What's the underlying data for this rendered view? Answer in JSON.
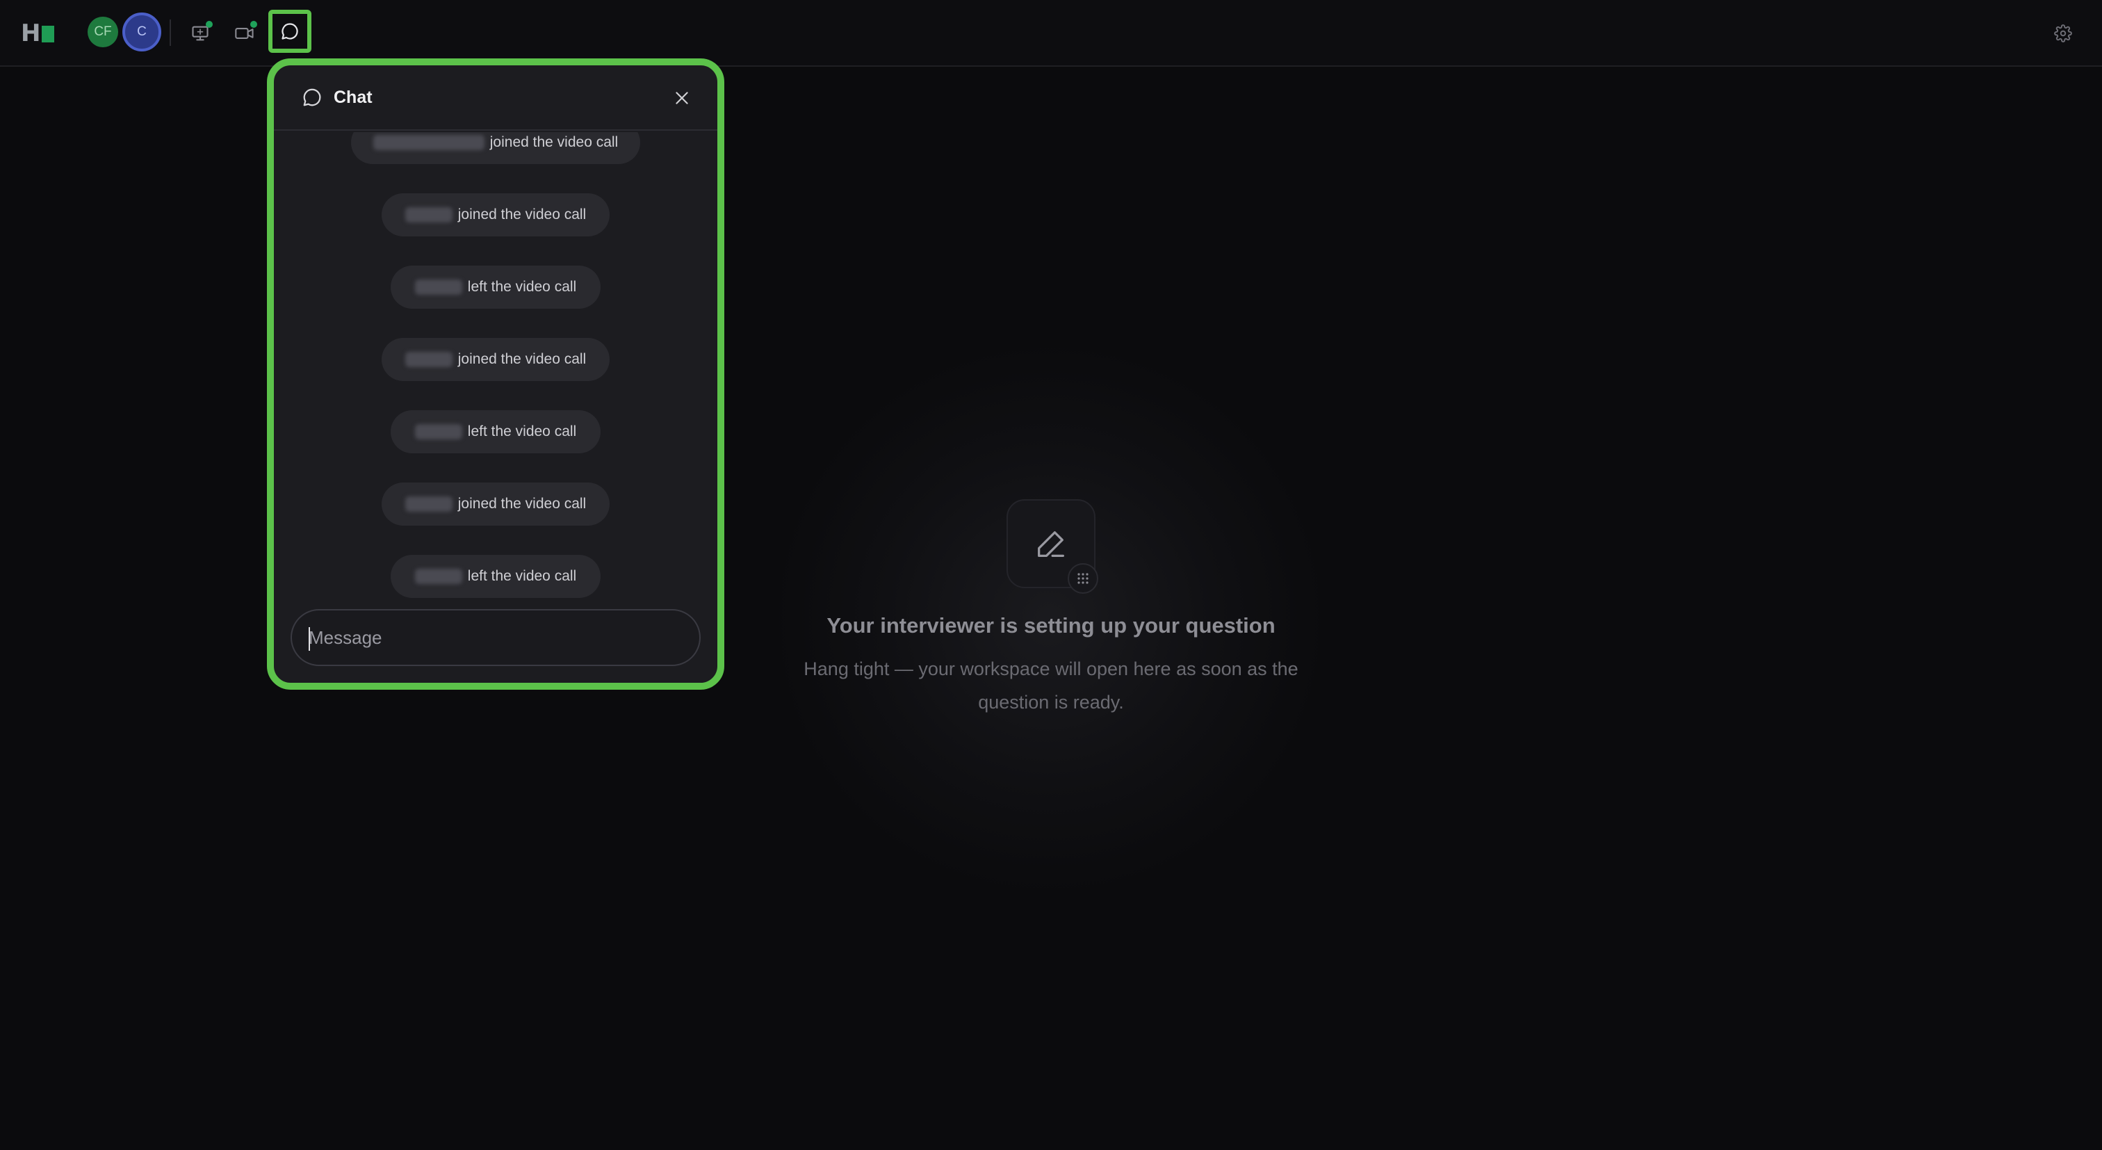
{
  "topbar": {
    "logo_letter": "H",
    "avatars": [
      {
        "initials": "CF",
        "color": "#1e7a3e"
      },
      {
        "initials": "C",
        "color": "#2c3a8a"
      }
    ],
    "icons": [
      "screen-share-icon",
      "video-camera-icon",
      "chat-bubble-icon",
      "gear-icon"
    ],
    "active_indicator_color": "#1fa25a"
  },
  "chat": {
    "title": "Chat",
    "highlight_color": "#5cc24a",
    "messages": [
      {
        "text": "joined the video call"
      },
      {
        "text": "joined the video call"
      },
      {
        "text": "left the video call"
      },
      {
        "text": "joined the video call"
      },
      {
        "text": "left the video call"
      },
      {
        "text": "joined the video call"
      },
      {
        "text": "left the video call"
      }
    ],
    "input_placeholder": "Message"
  },
  "main": {
    "title": "Your interviewer is setting up your question",
    "subtitle_line1": "Hang tight — your workspace will open here as soon as the",
    "subtitle_line2": "question is ready."
  }
}
